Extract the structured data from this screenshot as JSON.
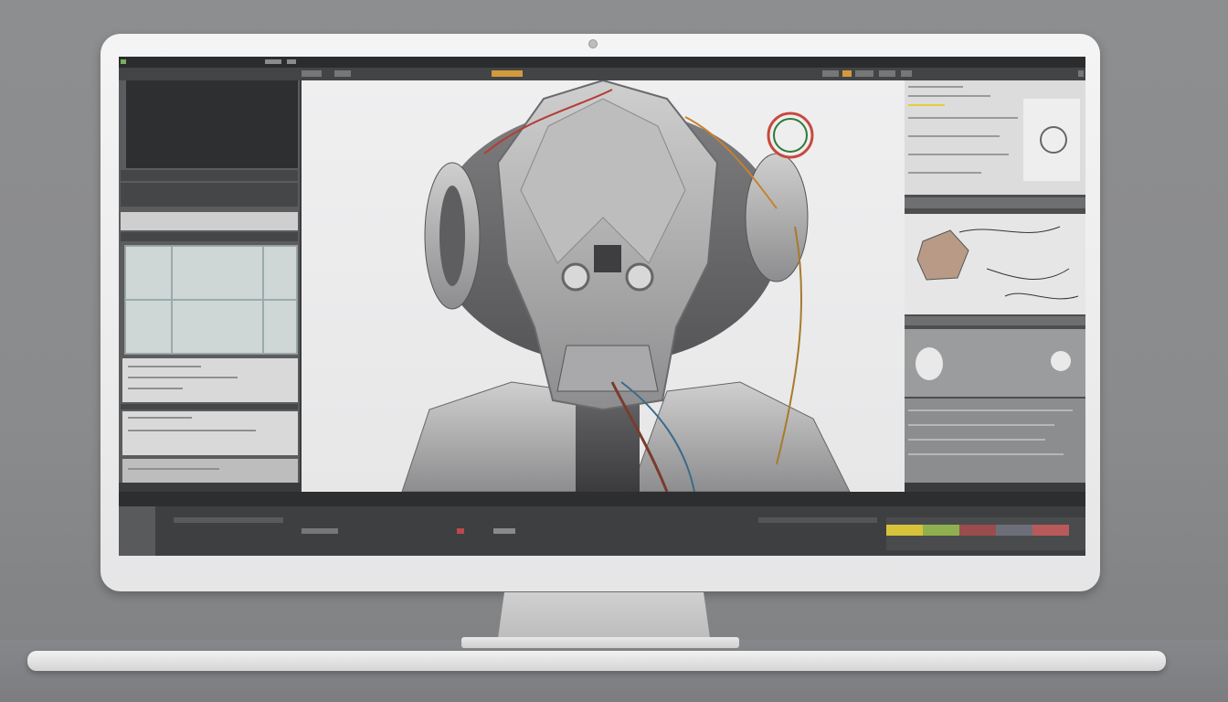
{
  "app": {
    "accent_color": "#d19a3b",
    "panel_color": "#4d4e50",
    "viewport_bg": "#ececed"
  },
  "viewport": {
    "subject": "robot-head-model"
  },
  "timeline": {
    "lane_colors": [
      "#d6c33a",
      "#8fb04e",
      "#9a4c4c",
      "#6c6f7a",
      "#b85a5a"
    ]
  }
}
